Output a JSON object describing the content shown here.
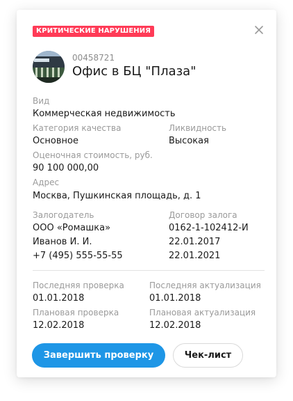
{
  "badge": {
    "text": "КРИТИЧЕСКИЕ НАРУШЕНИЯ",
    "color": "#ff3b57"
  },
  "close_icon": "close-icon",
  "object": {
    "id": "00458721",
    "title": "Офис в БЦ \"Плаза\""
  },
  "details": {
    "type_label": "Вид",
    "type_value": "Коммерческая недвижимость",
    "quality_label": "Категория качества",
    "quality_value": "Основное",
    "liquidity_label": "Ликвидность",
    "liquidity_value": "Высокая",
    "estimate_label": "Оценочная стоимость, руб.",
    "estimate_value": "90 100 000,00",
    "address_label": "Адрес",
    "address_value": "Москва, Пушкинская площадь, д. 1"
  },
  "pledge": {
    "pledger_label": "Залогодатель",
    "pledger_company": "ООО «Ромашка»",
    "pledger_person": "Иванов И. И.",
    "pledger_phone": "+7 (495) 555-55-55",
    "contract_label": "Договор залога",
    "contract_number": "0162-1-102412-И",
    "contract_date_start": "22.01.2017",
    "contract_date_end": "22.01.2021"
  },
  "checks": {
    "last_check_label": "Последняя проверка",
    "last_check_value": "01.01.2018",
    "last_update_label": "Последняя актуализация",
    "last_update_value": "01.01.2018",
    "planned_check_label": "Плановая проверка",
    "planned_check_value": "12.02.2018",
    "planned_update_label": "Плановая актуализация",
    "planned_update_value": "12.02.2018"
  },
  "actions": {
    "complete_label": "Завершить проверку",
    "checklist_label": "Чек-лист",
    "primary_color": "#1e96e6"
  }
}
